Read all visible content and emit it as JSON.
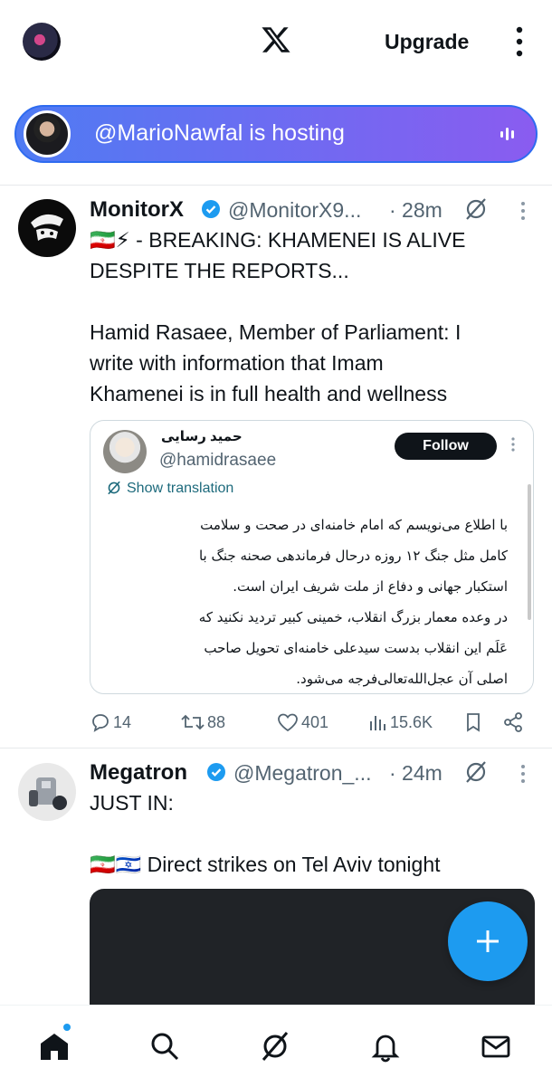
{
  "header": {
    "upgrade_label": "Upgrade"
  },
  "space": {
    "host_handle": "@MarioNawfal",
    "host_suffix": " is hosting"
  },
  "tweets": [
    {
      "name": "MonitorX",
      "handle": "@MonitorX9...",
      "time": "· 28m",
      "lines": [
        "🇮🇷⚡ - BREAKING: KHAMENEI IS ALIVE",
        "DESPITE THE REPORTS...",
        "",
        "Hamid Rasaee, Member of Parliament: I",
        "write with information that Imam",
        "Khamenei is in full health and wellness"
      ],
      "quote": {
        "name": "حمید رسایی",
        "handle": "@hamidrasaee",
        "follow_label": "Follow",
        "translate_label": "Show translation",
        "lines": [
          "با اطلاع می‌نویسم که امام خامنه‌ای در صحت و سلامت",
          "کامل مثل جنگ ۱۲ روزه درحال فرماندهی صحنه جنگ با",
          "استکبار جهانی و دفاع از ملت شریف ایران است.",
          "در وعده معمار بزرگ انقلاب، خمینی کبیر تردید نکنید که",
          "عَلَم این انقلاب بدست سیدعلی خامنه‌ای تحویل صاحب",
          "اصلی آن عجل‌الله‌تعالی‌فرجه می‌شود."
        ]
      },
      "actions": {
        "replies": "14",
        "reposts": "88",
        "likes": "401",
        "views": "15.6K"
      }
    },
    {
      "name": "Megatron",
      "handle": "@Megatron_...",
      "time": "· 24m",
      "lines": [
        "JUST IN:",
        "",
        "🇮🇷🇮🇱 Direct strikes on Tel Aviv tonight"
      ]
    }
  ],
  "colors": {
    "accent": "#1d9bf0",
    "space_gradient_start": "#4f7bf3",
    "space_gradient_end": "#8a5cf0"
  },
  "icons": {
    "nav": [
      "home-icon",
      "search-icon",
      "grok-icon",
      "bell-icon",
      "mail-icon"
    ]
  }
}
